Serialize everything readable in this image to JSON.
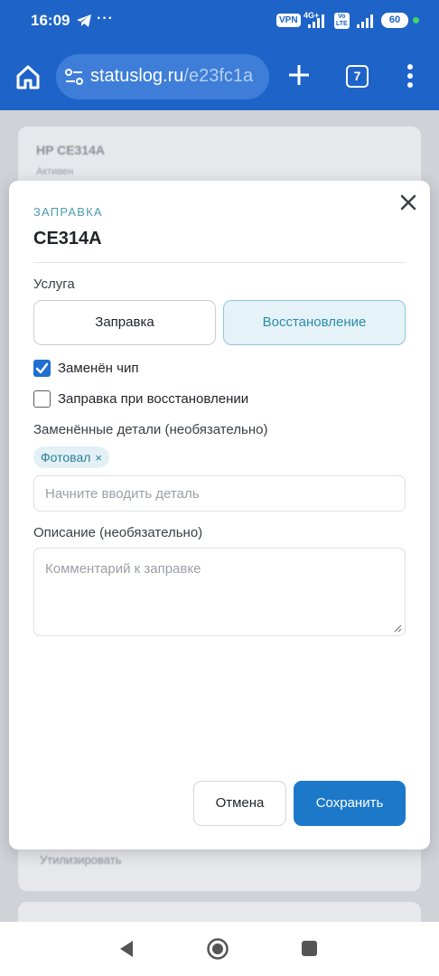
{
  "status_bar": {
    "time": "16:09",
    "vpn": "VPN",
    "network": "4G+",
    "volte": "Vo LTE",
    "battery": "60"
  },
  "browser": {
    "url_host": "statuslog.ru",
    "url_path": "/e23fc1a",
    "tab_count": "7"
  },
  "background": {
    "card_title": "HP CE314A",
    "card_subtitle": "Активен",
    "row_label": "Утилизировать"
  },
  "modal": {
    "kicker": "ЗАПРАВКА",
    "title": "CE314A",
    "service_label": "Услуга",
    "service_options": [
      "Заправка",
      "Восстановление"
    ],
    "selected_service": "Восстановление",
    "chip_replaced": {
      "label": "Заменён чип",
      "checked": true
    },
    "refill_on_restore": {
      "label": "Заправка при восстановлении",
      "checked": false
    },
    "parts_label": "Заменённые детали (необязательно)",
    "parts_tags": [
      "Фотовал"
    ],
    "parts_placeholder": "Начните вводить деталь",
    "description_label": "Описание (необязательно)",
    "description_placeholder": "Комментарий к заправке",
    "cancel_label": "Отмена",
    "save_label": "Сохранить"
  },
  "colors": {
    "primary": "#1e63c8",
    "accent": "#2a8bab",
    "save": "#1c78c9"
  }
}
